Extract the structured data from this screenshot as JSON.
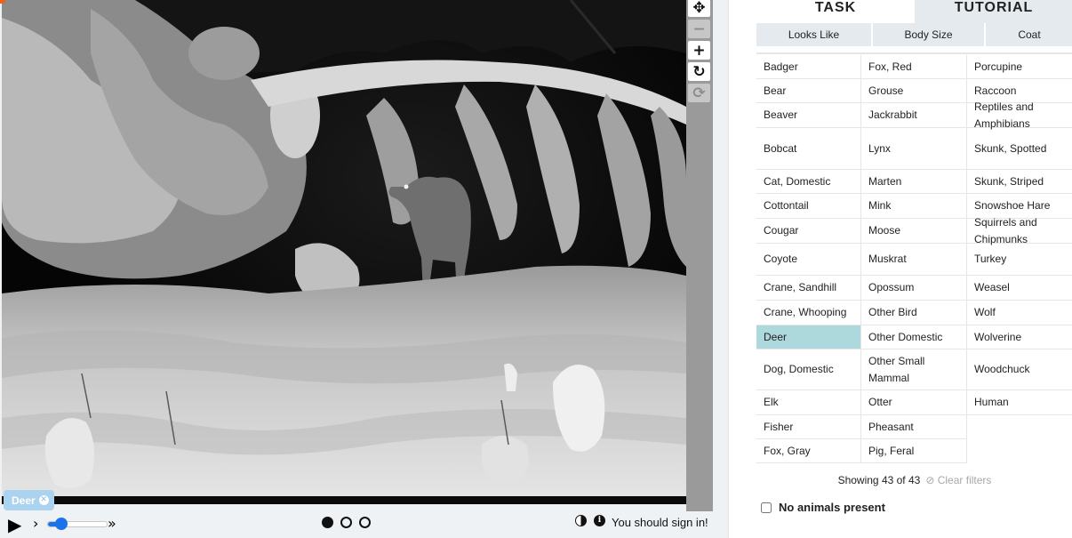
{
  "subject": {
    "tag_label": "Deer",
    "status_text": "You should sign in!",
    "frames": [
      "frame-1",
      "frame-2",
      "frame-3"
    ],
    "active_frame": 1,
    "playback_speed_fraction": 0.23,
    "tools": [
      "move-icon",
      "zoom-out-icon",
      "zoom-in-icon",
      "rotate-icon",
      "reset-icon"
    ],
    "image_description_colors": {
      "sky": "#0c0c0c",
      "snow": "#dcdcdc"
    }
  },
  "task": {
    "tabs": [
      {
        "label": "TASK",
        "active": true
      },
      {
        "label": "TUTORIAL",
        "active": false
      }
    ],
    "filters": [
      "Looks Like",
      "Body Size",
      "Coat"
    ],
    "choices": [
      "Badger",
      "Bear",
      "Beaver",
      "Bobcat",
      "Cat, Domestic",
      "Cottontail",
      "Cougar",
      "Coyote",
      "Crane, Sandhill",
      "Crane, Whooping",
      "Deer",
      "Dog, Domestic",
      "Elk",
      "Fisher",
      "Fox, Gray",
      "Fox, Red",
      "Grouse",
      "Jackrabbit",
      "Lynx",
      "Marten",
      "Mink",
      "Moose",
      "Muskrat",
      "Opossum",
      "Other Bird",
      "Other Domestic",
      "Other Small Mammal",
      "Otter",
      "Pheasant",
      "Pig, Feral",
      "Porcupine",
      "Raccoon",
      "Reptiles and Amphibians",
      "Skunk, Spotted",
      "Skunk, Striped",
      "Snowshoe Hare",
      "Squirrels and Chipmunks",
      "Turkey",
      "Weasel",
      "Wolf",
      "Wolverine",
      "Woodchuck",
      "Human"
    ],
    "selected_choice": "Deer",
    "showing_text": "Showing 43 of 43",
    "clear_filters_label": "Clear filters",
    "no_animals_label": "No animals present"
  },
  "colors": {
    "selected_choice": "#add8dc",
    "tag_chip": "#abd2ee",
    "slider": "#1a73e8"
  }
}
